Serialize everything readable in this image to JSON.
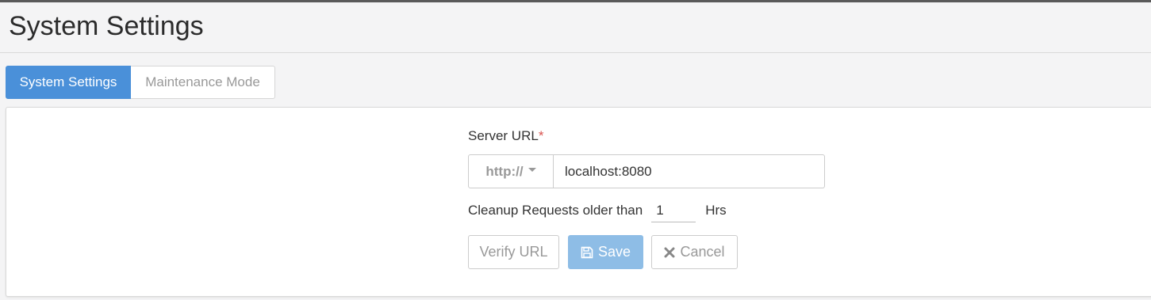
{
  "header": {
    "title": "System Settings"
  },
  "tabs": [
    {
      "label": "System Settings",
      "active": true
    },
    {
      "label": "Maintenance Mode",
      "active": false
    }
  ],
  "form": {
    "server_url_label": "Server URL",
    "required_marker": "*",
    "protocol": "http://",
    "url_value": "localhost:8080",
    "cleanup_label": "Cleanup Requests older than",
    "cleanup_value": "1",
    "cleanup_unit": "Hrs"
  },
  "buttons": {
    "verify": "Verify URL",
    "save": "Save",
    "cancel": "Cancel"
  },
  "icons": {
    "save": "floppy-disk-icon",
    "cancel": "x-icon",
    "protocol_dropdown": "caret-down-icon"
  },
  "colors": {
    "primary": "#4a90d9",
    "primary_disabled": "#8ebde6",
    "required": "#d9534f"
  }
}
